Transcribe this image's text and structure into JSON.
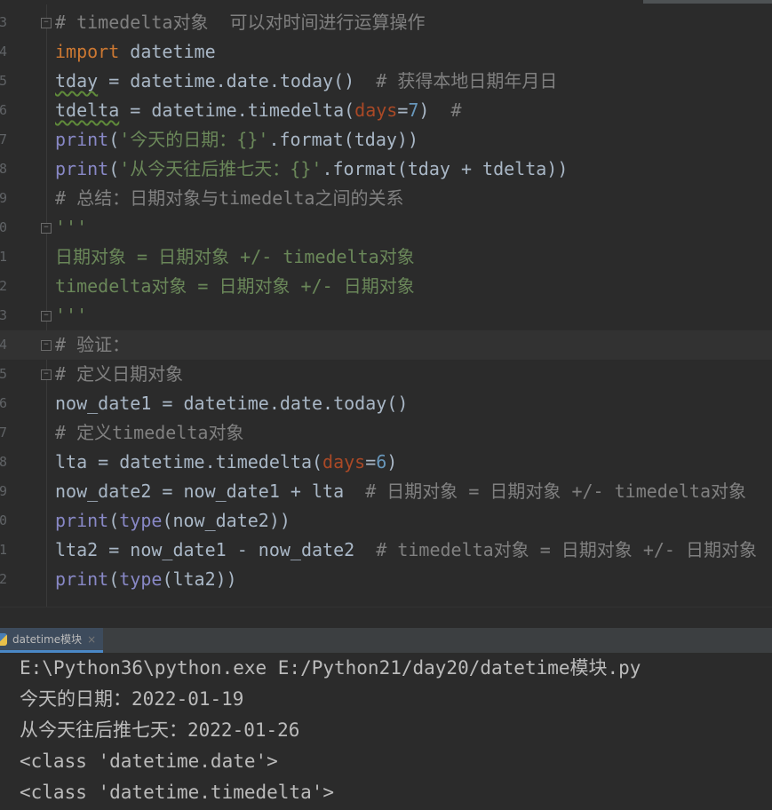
{
  "editor": {
    "lines": [
      {
        "num": "3",
        "fold": true,
        "tokens": [
          [
            "# timedelta对象  可以对时间进行运算操作",
            "c"
          ]
        ]
      },
      {
        "num": "4",
        "tokens": [
          [
            "import",
            "k"
          ],
          [
            " datetime",
            "t"
          ]
        ]
      },
      {
        "num": "5",
        "tokens": [
          [
            "tday",
            "t w"
          ],
          [
            " = datetime.date.today()  ",
            "t"
          ],
          [
            "# 获得本地日期年月日",
            "c"
          ]
        ]
      },
      {
        "num": "6",
        "tokens": [
          [
            "tdelta",
            "t w"
          ],
          [
            " = datetime.timedelta(",
            "t"
          ],
          [
            "days",
            "p"
          ],
          [
            "=",
            "t"
          ],
          [
            "7",
            "n"
          ],
          [
            ")  ",
            "t"
          ],
          [
            "#",
            "c"
          ]
        ]
      },
      {
        "num": "7",
        "tokens": [
          [
            "print",
            "b"
          ],
          [
            "(",
            "t"
          ],
          [
            "'今天的日期：{}'",
            "s"
          ],
          [
            ".format(tday))",
            "t"
          ]
        ]
      },
      {
        "num": "8",
        "tokens": [
          [
            "print",
            "b"
          ],
          [
            "(",
            "t"
          ],
          [
            "'从今天往后推七天：{}'",
            "s"
          ],
          [
            ".format(tday + tdelta))",
            "t"
          ]
        ]
      },
      {
        "num": "9",
        "tokens": [
          [
            "# 总结：日期对象与timedelta之间的关系",
            "c"
          ]
        ]
      },
      {
        "num": "0",
        "fold": true,
        "tokens": [
          [
            "'''",
            "s"
          ]
        ]
      },
      {
        "num": "1",
        "tokens": [
          [
            "日期对象 = 日期对象 +/- timedelta对象",
            "s"
          ]
        ]
      },
      {
        "num": "2",
        "tokens": [
          [
            "timedelta对象 = 日期对象 +/- 日期对象",
            "s"
          ]
        ]
      },
      {
        "num": "3",
        "fold": true,
        "tokens": [
          [
            "'''",
            "s"
          ]
        ]
      },
      {
        "num": "4",
        "fold": true,
        "current": true,
        "tokens": [
          [
            "# 验证：",
            "c"
          ]
        ]
      },
      {
        "num": "5",
        "fold": true,
        "tokens": [
          [
            "# 定义日期对象",
            "c"
          ]
        ]
      },
      {
        "num": "6",
        "tokens": [
          [
            "now_date1 = datetime.date.today()",
            "t"
          ]
        ]
      },
      {
        "num": "7",
        "tokens": [
          [
            "# 定义timedelta对象",
            "c"
          ]
        ]
      },
      {
        "num": "8",
        "tokens": [
          [
            "lta = datetime.timedelta(",
            "t"
          ],
          [
            "days",
            "p"
          ],
          [
            "=",
            "t"
          ],
          [
            "6",
            "n"
          ],
          [
            ")",
            "t"
          ]
        ]
      },
      {
        "num": "9",
        "tokens": [
          [
            "now_date2 = now_date1 + lta  ",
            "t"
          ],
          [
            "# 日期对象 = 日期对象 +/- timedelta对象",
            "c"
          ]
        ]
      },
      {
        "num": "0",
        "tokens": [
          [
            "print",
            "b"
          ],
          [
            "(",
            "t"
          ],
          [
            "type",
            "b"
          ],
          [
            "(now_date2))",
            "t"
          ]
        ]
      },
      {
        "num": "1",
        "tokens": [
          [
            "lta2 = now_date1 - now_date2  ",
            "t"
          ],
          [
            "# timedelta对象 = 日期对象 +/- 日期对象",
            "c"
          ]
        ]
      },
      {
        "num": "2",
        "tokens": [
          [
            "print",
            "b"
          ],
          [
            "(",
            "t"
          ],
          [
            "type",
            "b"
          ],
          [
            "(lta2))",
            "t"
          ]
        ]
      }
    ]
  },
  "run_panel": {
    "tab_label": "datetime模块",
    "close_glyph": "×",
    "output": [
      "E:\\Python36\\python.exe E:/Python21/day20/datetime模块.py",
      "今天的日期：2022-01-19",
      "从今天往后推七天：2022-01-26",
      "<class 'datetime.date'>",
      "<class 'datetime.timedelta'>"
    ]
  }
}
